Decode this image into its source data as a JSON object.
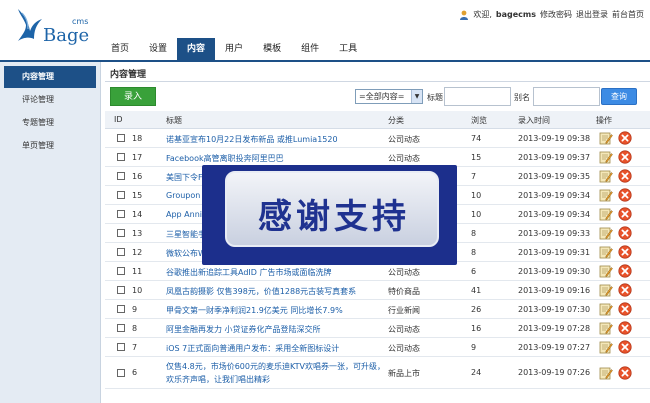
{
  "brand": {
    "name": "Bage",
    "sup": "cms"
  },
  "userbar": {
    "welcome": "欢迎,",
    "username": "bagecms",
    "change_password": "修改密码",
    "logout": "退出登录",
    "frontend_home": "前台首页"
  },
  "nav": [
    {
      "label": "首页",
      "active": false
    },
    {
      "label": "设置",
      "active": false
    },
    {
      "label": "内容",
      "active": true
    },
    {
      "label": "用户",
      "active": false
    },
    {
      "label": "模板",
      "active": false
    },
    {
      "label": "组件",
      "active": false
    },
    {
      "label": "工具",
      "active": false
    }
  ],
  "sidebar": [
    {
      "label": "内容管理",
      "active": true
    },
    {
      "label": "评论管理",
      "active": false
    },
    {
      "label": "专题管理",
      "active": false
    },
    {
      "label": "单页管理",
      "active": false
    }
  ],
  "page_title": "内容管理",
  "toolbar": {
    "add_label": "录入",
    "filter_value": "=全部内容=",
    "title_label": "标题",
    "alias_label": "别名",
    "search_label": "查询"
  },
  "table": {
    "headers": {
      "id": "ID",
      "title": "标题",
      "category": "分类",
      "views": "浏览",
      "time": "录入时间",
      "ops": "操作"
    },
    "rows": [
      {
        "id": "18",
        "title": "诺基亚宣布10月22日发布新品 或推Lumia1520",
        "category": "公司动态",
        "views": "74",
        "time": "2013-09-19 09:38"
      },
      {
        "id": "17",
        "title": "Facebook高管离职投奔阿里巴巴",
        "category": "公司动态",
        "views": "15",
        "time": "2013-09-19 09:37"
      },
      {
        "id": "16",
        "title": "美国下令F",
        "category": "",
        "views": "7",
        "time": "2013-09-19 09:35"
      },
      {
        "id": "15",
        "title": "Groupon",
        "category": "",
        "views": "10",
        "time": "2013-09-19 09:34"
      },
      {
        "id": "14",
        "title": "App Anni",
        "category": "",
        "views": "10",
        "time": "2013-09-19 09:34"
      },
      {
        "id": "13",
        "title": "三星智能手",
        "category": "",
        "views": "8",
        "time": "2013-09-19 09:33"
      },
      {
        "id": "12",
        "title": "微软公布W",
        "category": "",
        "views": "8",
        "time": "2013-09-19 09:31"
      },
      {
        "id": "11",
        "title": "谷歌推出新追踪工具AdID 广告市场或面临洗牌",
        "category": "公司动态",
        "views": "6",
        "time": "2013-09-19 09:30"
      },
      {
        "id": "10",
        "title": "凤凰古韵摄影 仅售398元，价值1288元古装写真套系",
        "category": "特价商品",
        "views": "41",
        "time": "2013-09-19 09:16"
      },
      {
        "id": "9",
        "title": "甲骨文第一财季净利润21.9亿美元 同比增长7.9%",
        "category": "行业新闻",
        "views": "26",
        "time": "2013-09-19 07:30"
      },
      {
        "id": "8",
        "title": "阿里金融再发力 小贷证券化产品登陆深交所",
        "category": "公司动态",
        "views": "16",
        "time": "2013-09-19 07:28"
      },
      {
        "id": "7",
        "title": "iOS 7正式面向普通用户发布：采用全新图标设计",
        "category": "公司动态",
        "views": "9",
        "time": "2013-09-19 07:27"
      },
      {
        "id": "6",
        "title": "仅售4.8元，市场价600元的麦乐迪KTV欢唱券一张，可升级，欢乐齐声唱，让我们唱出精彩",
        "category": "新品上市",
        "views": "24",
        "time": "2013-09-19 07:26"
      }
    ]
  },
  "watermark": {
    "text": "感谢支持"
  },
  "colors": {
    "nav_active": "#1d5087",
    "link": "#1d5fa8",
    "add_button": "#39a13a",
    "search_button": "#3c8be4",
    "watermark_bg": "#1c2f8c"
  }
}
